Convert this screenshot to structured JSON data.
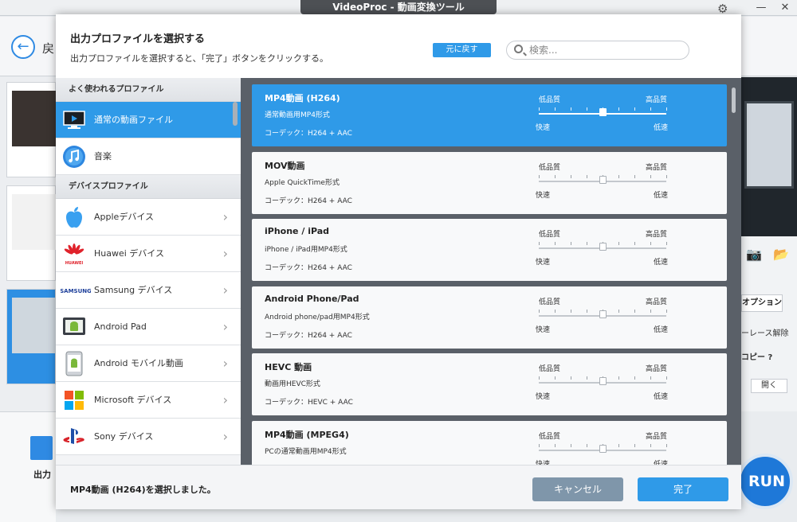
{
  "app": {
    "title": "VideoProc - 動画変換ツール",
    "back_label": "戻",
    "output_label": "出力",
    "options_label": "オプション",
    "side_label_1": "ーレース解除",
    "side_label_2": "コピー ?",
    "open_label": "開く",
    "run_label": "RUN",
    "window_buttons": [
      "—",
      "✕"
    ]
  },
  "dialog": {
    "title": "出力プロファイルを選択する",
    "subtitle": "出力プロファイルを選択すると、「完了」ボタンをクリックする。",
    "revert_label": "元に戻す",
    "search_placeholder": "検索..."
  },
  "sidebar": {
    "section1": "よく使われるプロファイル",
    "section2": "デバイスプロファイル",
    "common_items": [
      {
        "label": "通常の動画ファイル",
        "icon": "monitor-icon",
        "selected": true
      },
      {
        "label": "音楽",
        "icon": "music-icon",
        "selected": false
      }
    ],
    "device_items": [
      {
        "label": "Appleデバイス",
        "icon": "apple-icon"
      },
      {
        "label": "Huawei デバイス",
        "icon": "huawei-icon",
        "logo_text": "HUAWEI"
      },
      {
        "label": "Samsung デバイス",
        "icon": "samsung-icon",
        "logo_text": "SAMSUNG"
      },
      {
        "label": "Android Pad",
        "icon": "android-pad-icon"
      },
      {
        "label": "Android モバイル動画",
        "icon": "android-phone-icon"
      },
      {
        "label": "Microsoft デバイス",
        "icon": "microsoft-icon"
      },
      {
        "label": "Sony デバイス",
        "icon": "playstation-icon"
      }
    ]
  },
  "slider_labels": {
    "low_quality": "低品質",
    "high_quality": "高品質",
    "fast": "快速",
    "slow": "低速"
  },
  "profiles": [
    {
      "name": "MP4動画 (H264)",
      "desc": "通常動画用MP4形式",
      "codec": "コーデック：H264 + AAC",
      "quality": 0.5,
      "selected": true
    },
    {
      "name": "MOV動画",
      "desc": "Apple QuickTime形式",
      "codec": "コーデック：H264 + AAC",
      "quality": 0.5,
      "selected": false
    },
    {
      "name": "iPhone / iPad",
      "desc": "iPhone / iPad用MP4形式",
      "codec": "コーデック：H264 + AAC",
      "quality": 0.5,
      "selected": false
    },
    {
      "name": "Android Phone/Pad",
      "desc": "Android phone/pad用MP4形式",
      "codec": "コーデック：H264 + AAC",
      "quality": 0.5,
      "selected": false
    },
    {
      "name": "HEVC 動画",
      "desc": "動画用HEVC形式",
      "codec": "コーデック：HEVC + AAC",
      "quality": 0.5,
      "selected": false
    },
    {
      "name": "MP4動画 (MPEG4)",
      "desc": "PCの通常動画用MP4形式",
      "codec": "",
      "quality": 0.5,
      "selected": false
    }
  ],
  "footer": {
    "status": "MP4動画 (H264)を選択しました。",
    "cancel_label": "キャンセル",
    "done_label": "完了"
  },
  "colors": {
    "accent": "#2f9ae8",
    "cancel": "#7f96aa",
    "list_bg": "#5a6068"
  }
}
